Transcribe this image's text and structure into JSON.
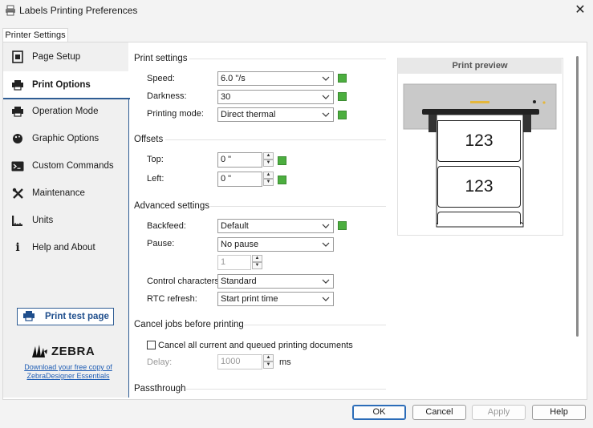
{
  "window": {
    "title": "Labels Printing Preferences"
  },
  "tabs": [
    {
      "label": "Printer Settings"
    }
  ],
  "sidebar": {
    "items": [
      {
        "label": "Page Setup",
        "icon": "page-setup-icon"
      },
      {
        "label": "Print Options",
        "icon": "printer-icon",
        "active": true
      },
      {
        "label": "Operation Mode",
        "icon": "printer-icon"
      },
      {
        "label": "Graphic Options",
        "icon": "palette-icon"
      },
      {
        "label": "Custom Commands",
        "icon": "terminal-icon"
      },
      {
        "label": "Maintenance",
        "icon": "tools-icon"
      },
      {
        "label": "Units",
        "icon": "ruler-icon"
      },
      {
        "label": "Help and About",
        "icon": "info-icon"
      }
    ],
    "print_test_label": "Print test page",
    "brand": "ZEBRA",
    "download_link": "Download your free copy of ZebraDesigner Essentials"
  },
  "print_settings": {
    "title": "Print settings",
    "speed_label": "Speed:",
    "speed_value": "6.0 \"/s",
    "darkness_label": "Darkness:",
    "darkness_value": "30",
    "mode_label": "Printing mode:",
    "mode_value": "Direct thermal"
  },
  "offsets": {
    "title": "Offsets",
    "top_label": "Top:",
    "top_value": "0 \"",
    "left_label": "Left:",
    "left_value": "0 \""
  },
  "advanced": {
    "title": "Advanced settings",
    "backfeed_label": "Backfeed:",
    "backfeed_value": "Default",
    "pause_label": "Pause:",
    "pause_value": "No pause",
    "pause_count": "1",
    "control_label": "Control characters:",
    "control_value": "Standard",
    "rtc_label": "RTC refresh:",
    "rtc_value": "Start print time"
  },
  "cancel_jobs": {
    "title": "Cancel jobs before printing",
    "checkbox_label": "Cancel all current and queued printing documents",
    "delay_label": "Delay:",
    "delay_value": "1000",
    "delay_unit": "ms"
  },
  "passthrough": {
    "title": "Passthrough"
  },
  "preview": {
    "title": "Print preview",
    "label_text_1": "123",
    "label_text_2": "123"
  },
  "buttons": {
    "ok": "OK",
    "cancel": "Cancel",
    "apply": "Apply",
    "help": "Help"
  },
  "colors": {
    "accent": "#2f5d94",
    "indicator": "#4cae3f",
    "link": "#1f5db4"
  }
}
